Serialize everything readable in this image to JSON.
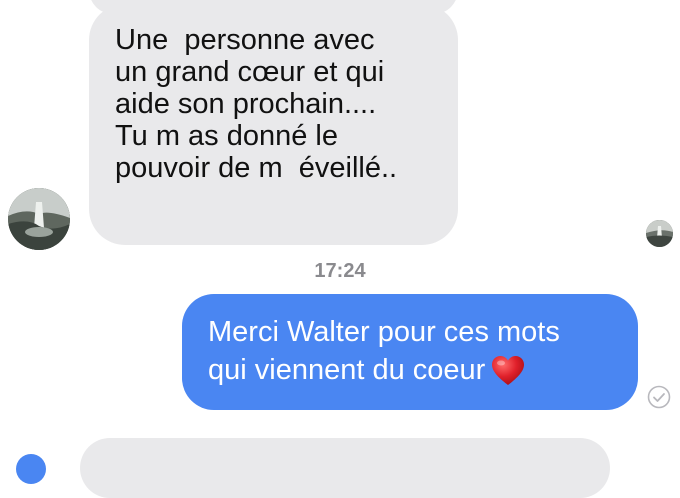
{
  "messages": {
    "incoming": {
      "lines": [
        "Une  personne avec",
        "un grand cœur et qui",
        "aide son prochain....",
        "Tu m as donné le",
        "pouvoir de m  éveillé.."
      ]
    },
    "timestamp": "17:24",
    "outgoing": {
      "lines": [
        "Merci Walter pour ces mots",
        "qui viennent du coeur"
      ],
      "emoji": "heart-emoji"
    }
  },
  "colors": {
    "incoming_bubble": "#e9e9eb",
    "outgoing_bubble": "#4a86f2",
    "timestamp_text": "#8a8a8e"
  },
  "icons": {
    "read_receipt": "check-circle-icon",
    "contact_avatar": "waterfall-avatar"
  }
}
